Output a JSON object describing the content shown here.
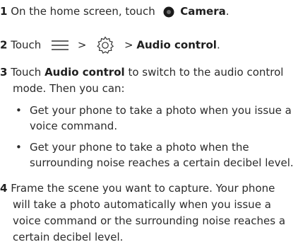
{
  "steps": [
    {
      "number": "1",
      "lead": "On the home screen, touch",
      "target_label": "Camera",
      "end": "."
    },
    {
      "number": "2",
      "lead": "Touch",
      "sep1": ">",
      "sep2": ">",
      "target_label": "Audio control",
      "end": "."
    },
    {
      "number": "3",
      "lead": "Touch",
      "target_label": "Audio control",
      "rest_line1": "to switch to the audio control",
      "line2": "mode. Then you can:",
      "bullets": [
        {
          "line1": "Get your phone to take a photo when you issue a",
          "line2": "voice command."
        },
        {
          "line1": "Get your phone to take a photo when the",
          "line2": "surrounding noise reaches a certain decibel level."
        }
      ]
    },
    {
      "number": "4",
      "line1": "Frame the scene you want to capture. Your phone",
      "line2": "will take a photo automatically when you issue a",
      "line3": "voice command or the surrounding noise reaches a",
      "line4": "certain decibel level."
    }
  ],
  "bullet_char": "•",
  "icons": {
    "camera": "camera-icon",
    "menu": "menu-icon",
    "settings": "settings-gear-icon"
  }
}
